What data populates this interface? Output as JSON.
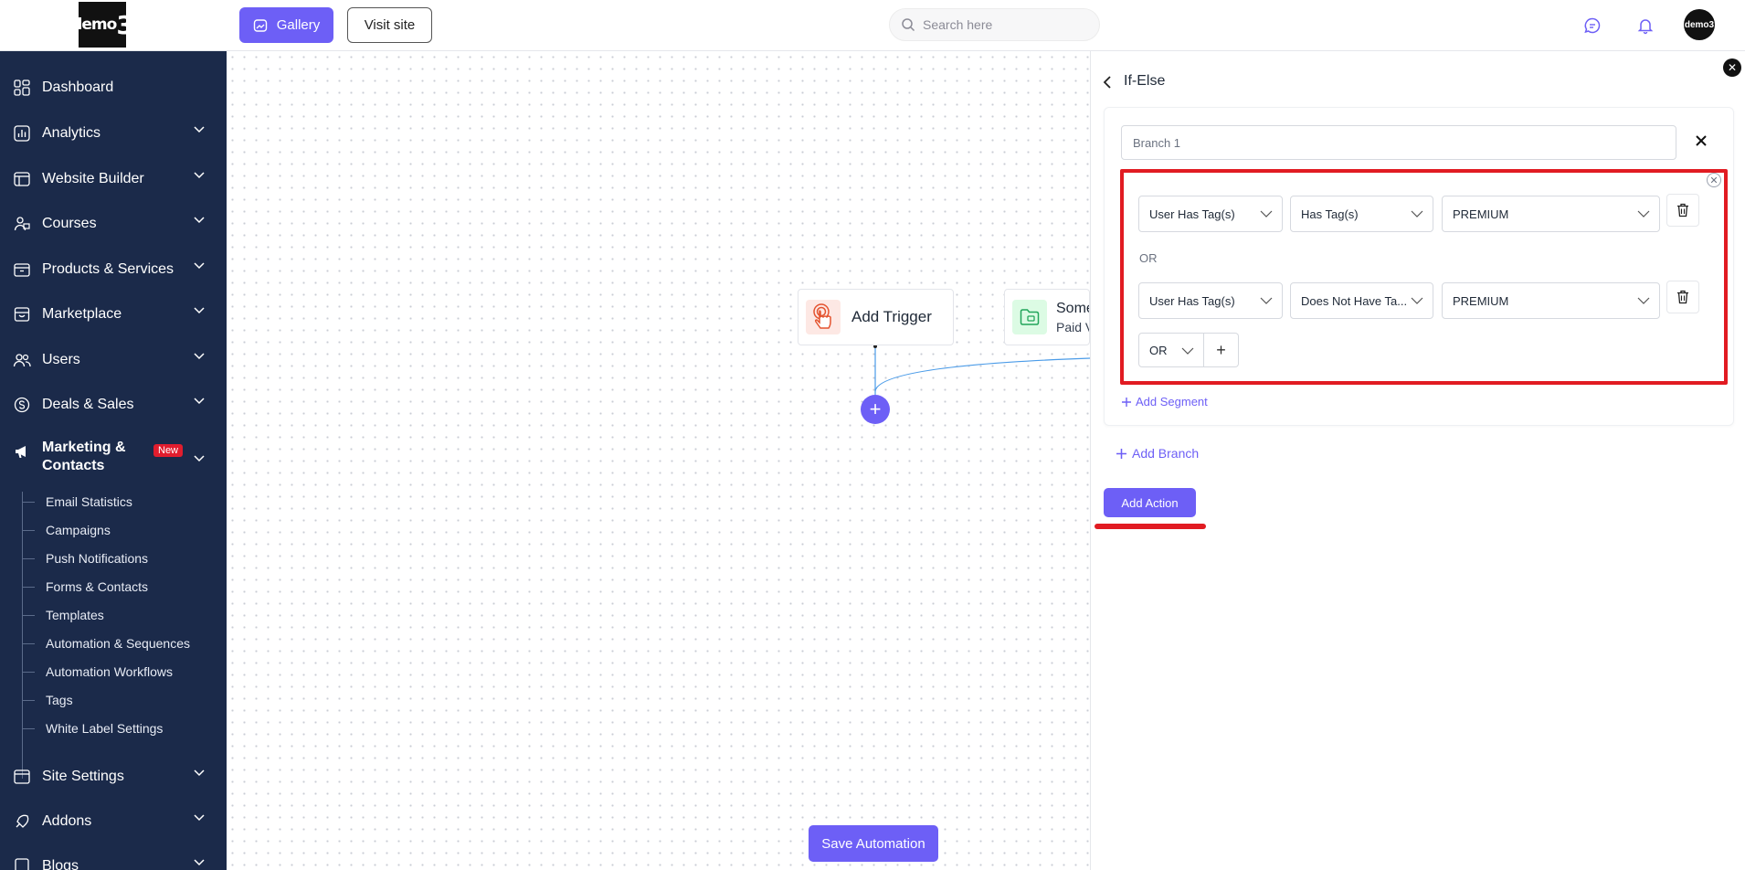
{
  "header": {
    "logo_text": "demo",
    "logo_digit": "3",
    "gallery_label": "Gallery",
    "visit_site_label": "Visit site",
    "search_placeholder": "Search here",
    "avatar_text": "demo3"
  },
  "sidebar": {
    "items": [
      {
        "label": "Dashboard",
        "icon": "dashboard-icon"
      },
      {
        "label": "Analytics",
        "icon": "analytics-icon"
      },
      {
        "label": "Website Builder",
        "icon": "website-icon"
      },
      {
        "label": "Courses",
        "icon": "courses-icon"
      },
      {
        "label": "Products & Services",
        "icon": "products-icon"
      },
      {
        "label": "Marketplace",
        "icon": "marketplace-icon"
      },
      {
        "label": "Users",
        "icon": "users-icon"
      },
      {
        "label": "Deals & Sales",
        "icon": "deals-icon"
      },
      {
        "label": "Marketing & Contacts",
        "icon": "megaphone-icon",
        "badge": "New"
      },
      {
        "label": "Site Settings",
        "icon": "settings-icon"
      },
      {
        "label": "Addons",
        "icon": "addons-icon"
      },
      {
        "label": "Blogs",
        "icon": "blogs-icon"
      }
    ],
    "marketing_line1": "Marketing &",
    "marketing_line2": "Contacts",
    "subitems": [
      "Email Statistics",
      "Campaigns",
      "Push Notifications",
      "Forms & Contacts",
      "Templates",
      "Automation & Sequences",
      "Automation Workflows",
      "Tags",
      "White Label Settings"
    ]
  },
  "canvas": {
    "trigger_label": "Add Trigger",
    "node2_title": "Some",
    "node2_subtitle": "Paid V",
    "add_node": "+",
    "save_label": "Save Automation"
  },
  "panel": {
    "title": "If-Else",
    "branch_name": "Branch 1",
    "conditions": [
      {
        "field": "User Has Tag(s)",
        "operator": "Has Tag(s)",
        "value": "PREMIUM"
      },
      {
        "field": "User Has Tag(s)",
        "operator": "Does Not Have Ta...",
        "value": "PREMIUM"
      }
    ],
    "or_label": "OR",
    "logic_select": "OR",
    "add_condition": "+",
    "add_segment": "Add Segment",
    "add_branch": "Add Branch",
    "add_action": "Add Action"
  },
  "colors": {
    "sidebar_bg": "#1b2a4a",
    "accent": "#6d5ff6",
    "highlight": "#e11b22"
  }
}
